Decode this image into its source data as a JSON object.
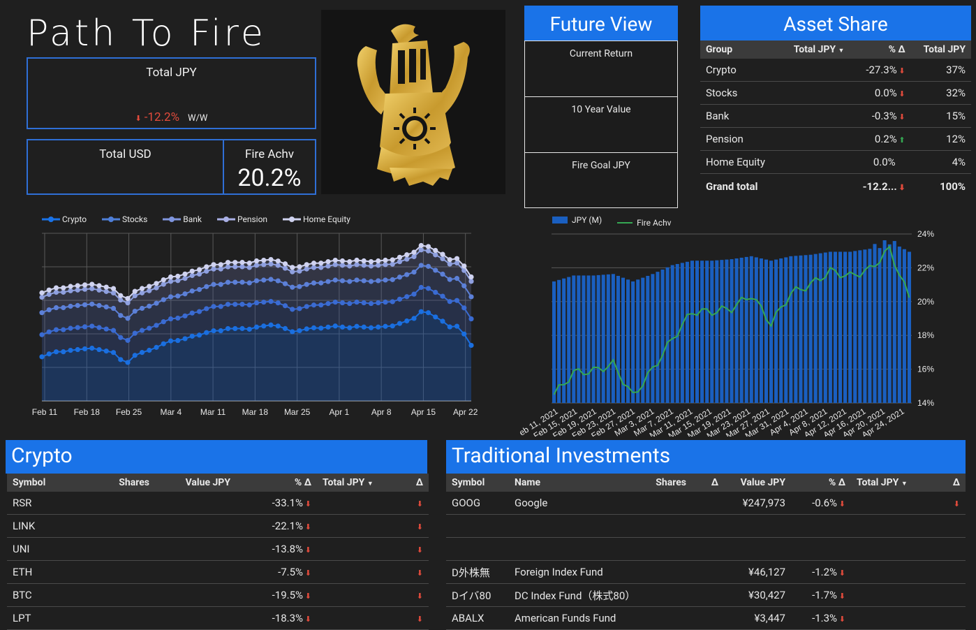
{
  "header": {
    "title": "Path To Fire"
  },
  "kpis": {
    "total_jpy_label": "Total JPY",
    "total_jpy_delta": "-12.2%",
    "total_jpy_delta_unit": "W/W",
    "total_usd_label": "Total USD",
    "fire_label": "Fire Achv",
    "fire_value": "20.2%"
  },
  "emblem": {
    "name": "sun-knight-emblem"
  },
  "future_view": {
    "title": "Future View",
    "cards": [
      {
        "label": "Current Return"
      },
      {
        "label": "10 Year Value"
      },
      {
        "label": "Fire Goal JPY"
      }
    ]
  },
  "asset_share": {
    "title": "Asset Share",
    "columns": [
      "Group",
      "Total JPY",
      "% Δ",
      "Total JPY"
    ],
    "rows": [
      {
        "group": "Crypto",
        "pct": "-27.3%",
        "dir": "down",
        "share": "37%"
      },
      {
        "group": "Stocks",
        "pct": "0.0%",
        "dir": "down",
        "share": "32%"
      },
      {
        "group": "Bank",
        "pct": "-0.3%",
        "dir": "down",
        "share": "15%"
      },
      {
        "group": "Pension",
        "pct": "0.2%",
        "dir": "up",
        "share": "12%"
      },
      {
        "group": "Home Equity",
        "pct": "0.0%",
        "dir": "none",
        "share": "4%"
      }
    ],
    "total": {
      "group": "Grand total",
      "pct": "-12.2...",
      "dir": "down",
      "share": "100%"
    }
  },
  "area_chart": {
    "legend": [
      "Crypto",
      "Stocks",
      "Bank",
      "Pension",
      "Home Equity"
    ],
    "x_ticks": [
      "Feb 11",
      "Feb 18",
      "Feb 25",
      "Mar 4",
      "Mar 11",
      "Mar 18",
      "Mar 25",
      "Apr 1",
      "Apr 8",
      "Apr 15",
      "Apr 22"
    ]
  },
  "bar_chart": {
    "legend": [
      "JPY (M)",
      "Fire Achv"
    ],
    "y_ticks": [
      "24%",
      "22%",
      "20%",
      "18%",
      "16%",
      "14%"
    ],
    "x_ticks": [
      "eb 11, 2021",
      "Feb 15, 2021",
      "Feb 19, 2021",
      "Feb 23, 2021",
      "Feb 27, 2021",
      "Mar 3, 2021",
      "Mar 7, 2021",
      "Mar 11, 2021",
      "Mar 15, 2021",
      "Mar 19, 2021",
      "Mar 23, 2021",
      "Mar 27, 2021",
      "Mar 31, 2021",
      "Apr 4, 2021",
      "Apr 8, 2021",
      "Apr 12, 2021",
      "Apr 16, 2021",
      "Apr 20, 2021",
      "Apr 24, 2021"
    ]
  },
  "chart_data": [
    {
      "type": "area",
      "stacked": true,
      "categories": [
        "Feb 11",
        "Feb 18",
        "Feb 25",
        "Mar 4",
        "Mar 11",
        "Mar 18",
        "Mar 25",
        "Apr 1",
        "Apr 8",
        "Apr 15",
        "Apr 22"
      ],
      "series": [
        {
          "name": "Crypto",
          "values": [
            1.0,
            1.1,
            1.0,
            1.2,
            1.35,
            1.45,
            1.4,
            1.45,
            1.45,
            1.6,
            1.5
          ]
        },
        {
          "name": "Stocks",
          "values": [
            0.5,
            0.5,
            0.5,
            0.5,
            0.55,
            0.55,
            0.5,
            0.55,
            0.55,
            0.55,
            0.6
          ]
        },
        {
          "name": "Bank",
          "values": [
            0.5,
            0.5,
            0.5,
            0.5,
            0.5,
            0.5,
            0.5,
            0.5,
            0.5,
            0.5,
            0.5
          ]
        },
        {
          "name": "Pension",
          "values": [
            0.35,
            0.35,
            0.35,
            0.35,
            0.35,
            0.35,
            0.35,
            0.35,
            0.35,
            0.35,
            0.35
          ]
        },
        {
          "name": "Home Equity",
          "values": [
            0.1,
            0.1,
            0.1,
            0.1,
            0.1,
            0.1,
            0.1,
            0.1,
            0.1,
            0.1,
            0.1
          ]
        }
      ],
      "grid": true,
      "legend": "top"
    },
    {
      "type": "bar",
      "categories": [
        "Feb 11",
        "Feb 15",
        "Feb 19",
        "Feb 23",
        "Feb 27",
        "Mar 3",
        "Mar 7",
        "Mar 11",
        "Mar 15",
        "Mar 19",
        "Mar 23",
        "Mar 27",
        "Mar 31",
        "Apr 4",
        "Apr 8",
        "Apr 12",
        "Apr 16",
        "Apr 20",
        "Apr 24"
      ],
      "series": [
        {
          "name": "JPY (M)",
          "values": [
            0.82,
            0.86,
            0.86,
            0.87,
            0.82,
            0.87,
            0.93,
            0.96,
            0.96,
            0.97,
            0.99,
            0.96,
            0.99,
            1.0,
            1.02,
            1.02,
            1.04,
            1.09,
            1.02
          ]
        },
        {
          "name": "Fire Achv",
          "axis": "right",
          "values": [
            14.5,
            15.8,
            15.9,
            16.3,
            14.4,
            16.0,
            17.8,
            19.4,
            19.4,
            19.6,
            20.4,
            18.7,
            20.5,
            21.0,
            21.8,
            21.5,
            21.9,
            23.1,
            20.2
          ]
        }
      ],
      "y2_ticks": [
        "14%",
        "16%",
        "18%",
        "20%",
        "22%",
        "24%"
      ],
      "ylim2": [
        14,
        24
      ],
      "grid": true,
      "legend": "top-left"
    }
  ],
  "crypto": {
    "title": "Crypto",
    "columns": [
      "Symbol",
      "Shares",
      "Value JPY",
      "% Δ",
      "Total JPY",
      "Δ"
    ],
    "rows": [
      {
        "symbol": "RSR",
        "pct": "-33.1%"
      },
      {
        "symbol": "LINK",
        "pct": "-22.1%"
      },
      {
        "symbol": "UNI",
        "pct": "-13.8%"
      },
      {
        "symbol": "ETH",
        "pct": "-7.5%"
      },
      {
        "symbol": "BTC",
        "pct": "-19.5%"
      },
      {
        "symbol": "LPT",
        "pct": "-18.3%"
      }
    ]
  },
  "traditional": {
    "title": "Traditional Investments",
    "columns": [
      "Symbol",
      "Name",
      "Shares",
      "Δ",
      "Value JPY",
      "% Δ",
      "Total JPY",
      "Δ"
    ],
    "rows": [
      {
        "symbol": "GOOG",
        "name": "Google",
        "value": "¥247,973",
        "pct": "-0.6%",
        "arrow_total": true
      },
      {
        "symbol": "",
        "name": "",
        "value": "",
        "pct": "",
        "arrow_total": false
      },
      {
        "symbol": "",
        "name": "",
        "value": "",
        "pct": "",
        "arrow_total": false
      },
      {
        "symbol": "D外株無",
        "name": "Foreign Index Fund",
        "value": "¥46,127",
        "pct": "-1.2%",
        "arrow_total": false
      },
      {
        "symbol": "Dイバ80",
        "name": "DC Index Fund（株式80）",
        "value": "¥30,427",
        "pct": "-1.7%",
        "arrow_total": false
      },
      {
        "symbol": "ABALX",
        "name": "American Funds Fund",
        "value": "¥3,447",
        "pct": "-1.3%",
        "arrow_total": false
      }
    ]
  },
  "colors": {
    "accent": "#1a73e8",
    "down": "#e24b3c",
    "up": "#35a853",
    "gold": "#d6a93a"
  }
}
